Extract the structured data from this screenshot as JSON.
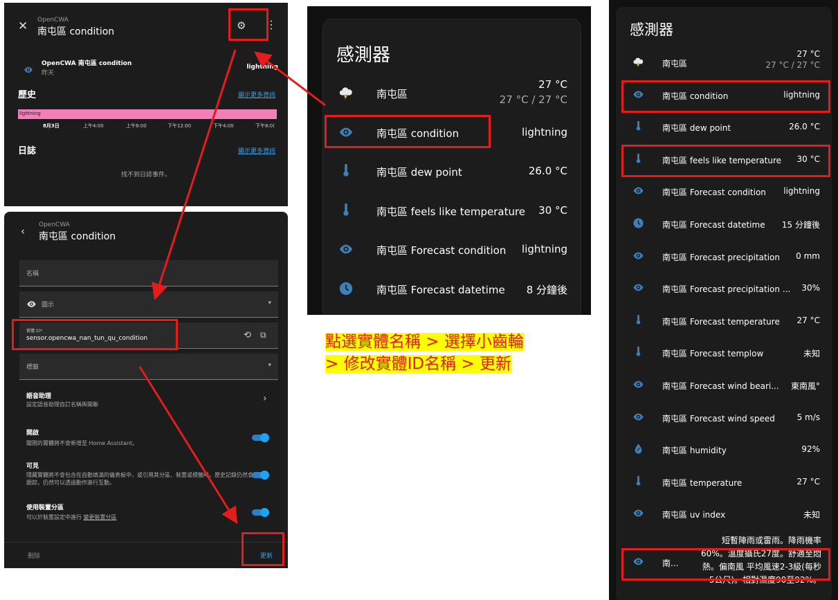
{
  "dialog": {
    "subtitle": "OpenCWA",
    "title": "南屯區 condition",
    "entity_name": "OpenCWA 南屯區 condition",
    "entity_time": "昨天",
    "entity_state": "lightning",
    "history_title": "歷史",
    "history_link": "顯示更多資訊",
    "bar_label": "lightning",
    "ticks": [
      "8月3日",
      "上午4:00",
      "上午8:00",
      "下午12:00",
      "下午4:00",
      "下午8:0("
    ],
    "logbook_title": "日誌",
    "logbook_link": "顯示更多資訊",
    "logbook_empty": "找不到日誌事件。"
  },
  "settings": {
    "subtitle": "OpenCWA",
    "title": "南屯區 condition",
    "name_label": "名稱",
    "icon_label": "圖示",
    "entity_id_label": "實體 ID*",
    "entity_id_value": "sensor.opencwa_nan_tun_qu_condition",
    "labels_label": "標籤",
    "voice_title": "語音助理",
    "voice_desc": "設定語音助理自訂名稱與開聯",
    "enabled_title": "開啟",
    "enabled_desc": "關閉的實體將不會新增至 Home Assistant。",
    "visible_title": "可見",
    "visible_desc": "隱藏實體將不會包含在自動填滿的儀表板中，或引用其分區、裝置或標籤時。歷史記錄仍然會跟踪，仍然可以透過動作進行互動。",
    "area_title": "使用裝置分區",
    "area_desc": "可以於裝置設定中進行",
    "area_link": "變更裝置分區",
    "delete_label": "刪除",
    "update_label": "更新"
  },
  "card_zoom": {
    "title": "感測器",
    "rows": [
      {
        "name": "南屯區",
        "value": "27 °C",
        "sub": "27 °C / 27 °C",
        "icon": "weather-lightning-icon"
      },
      {
        "name": "南屯區 condition",
        "value": "lightning",
        "icon": "eye-icon"
      },
      {
        "name": "南屯區 dew point",
        "value": "26.0 °C",
        "icon": "thermometer-icon"
      },
      {
        "name": "南屯區 feels like temperature",
        "value": "30 °C",
        "icon": "thermometer-icon"
      },
      {
        "name": "南屯區 Forecast condition",
        "value": "lightning",
        "icon": "eye-icon"
      },
      {
        "name": "南屯區 Forecast datetime",
        "value": "8 分鐘後",
        "icon": "clock-icon"
      }
    ]
  },
  "caption": {
    "line1": "點選實體名稱 > 選擇小齒輪",
    "line2": "> 修改實體ID名稱 > 更新"
  },
  "card_full": {
    "title": "感測器",
    "rows": [
      {
        "name": "南屯區",
        "value": "27 °C",
        "sub": "27 °C / 27 °C",
        "icon": "weather-lightning-icon"
      },
      {
        "name": "南屯區 condition",
        "value": "lightning",
        "icon": "eye-icon"
      },
      {
        "name": "南屯區 dew point",
        "value": "26.0 °C",
        "icon": "thermometer-icon"
      },
      {
        "name": "南屯區 feels like temperature",
        "value": "30 °C",
        "icon": "thermometer-icon"
      },
      {
        "name": "南屯區 Forecast condition",
        "value": "lightning",
        "icon": "eye-icon"
      },
      {
        "name": "南屯區 Forecast datetime",
        "value": "15 分鐘後",
        "icon": "clock-icon"
      },
      {
        "name": "南屯區 Forecast precipitation",
        "value": "0 mm",
        "icon": "eye-icon"
      },
      {
        "name": "南屯區 Forecast precipitation ...",
        "value": "30%",
        "icon": "eye-icon"
      },
      {
        "name": "南屯區 Forecast temperature",
        "value": "27 °C",
        "icon": "thermometer-icon"
      },
      {
        "name": "南屯區 Forecast templow",
        "value": "未知",
        "icon": "thermometer-icon"
      },
      {
        "name": "南屯區 Forecast wind beari...",
        "value": "東南風°",
        "icon": "eye-icon"
      },
      {
        "name": "南屯區 Forecast wind speed",
        "value": "5 m/s",
        "icon": "eye-icon"
      },
      {
        "name": "南屯區 humidity",
        "value": "92%",
        "icon": "water-percent-icon"
      },
      {
        "name": "南屯區 temperature",
        "value": "27 °C",
        "icon": "thermometer-icon"
      },
      {
        "name": "南屯區 uv index",
        "value": "未知",
        "icon": "eye-icon"
      }
    ],
    "forecast_name": "南...",
    "forecast_text_lines": [
      "短暫陣雨或雷雨。降雨機率",
      "60%。溫度攝氏27度。舒適至悶",
      "熱。偏南風 平均風速2-3級(每秒",
      "5公尺)。相對濕度90至92%。"
    ]
  },
  "colors": {
    "accent": "#3a9ee3",
    "annotation_red": "#e41c1c",
    "icon_blue": "#3d7fb8",
    "history_bar": "#f27fb8"
  }
}
